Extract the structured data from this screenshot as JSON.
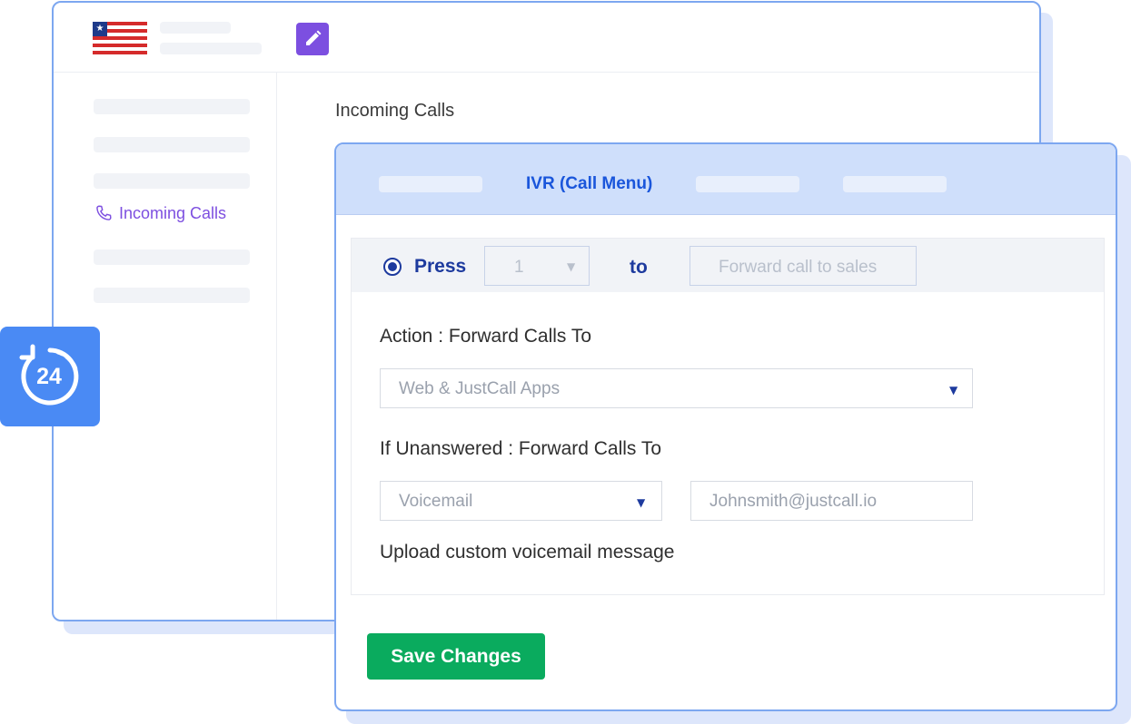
{
  "colors": {
    "accent_purple": "#7c4fe0",
    "accent_blue": "#1a56db",
    "navy": "#1d3a9e",
    "badge_blue": "#4a8af4",
    "save_green": "#0aab5e",
    "border_blue": "#7da7f0"
  },
  "icons": {
    "flag": "us-flag-icon",
    "edit": "pencil-icon",
    "phone": "phone-icon",
    "badge": "24-hour-support-icon"
  },
  "badge": {
    "label": "24"
  },
  "back_window": {
    "sidebar_active_label": "Incoming Calls",
    "section_title": "Incoming Calls"
  },
  "front_window": {
    "active_tab": "IVR (Call Menu)",
    "press_row": {
      "press_label": "Press",
      "key_value": "1",
      "to_label": "to",
      "destination_placeholder": "Forward call to sales"
    },
    "action_label": "Action : Forward Calls To",
    "action_select_value": "Web & JustCall Apps",
    "unanswered_label": "If Unanswered : Forward Calls To",
    "unanswered_select_value": "Voicemail",
    "email_placeholder": "Johnsmith@justcall.io",
    "upload_label": "Upload custom voicemail message",
    "save_button": "Save Changes"
  }
}
